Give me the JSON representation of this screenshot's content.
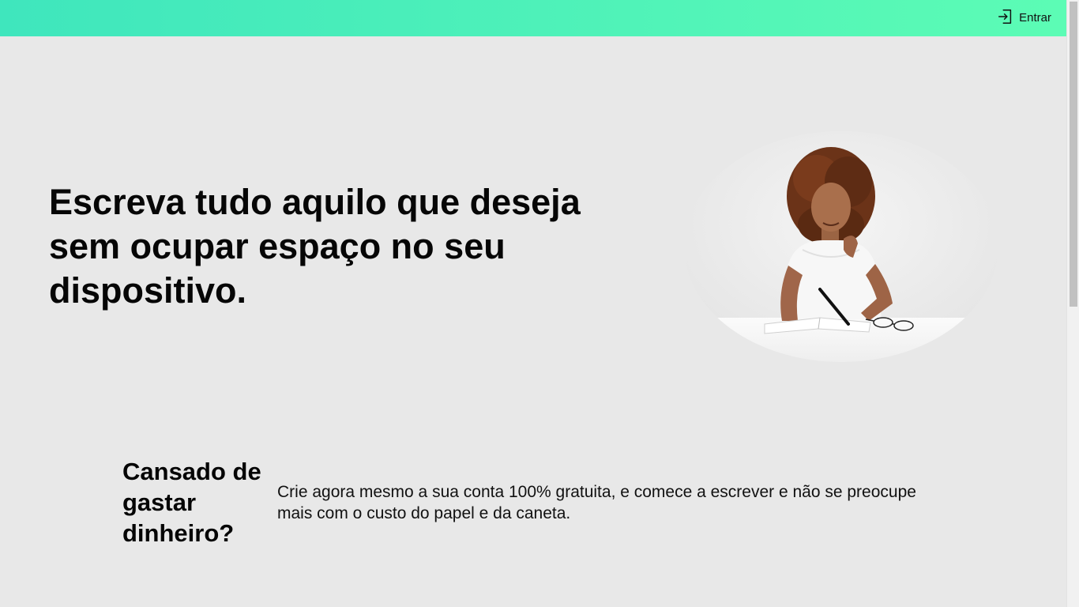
{
  "header": {
    "login_label": "Entrar",
    "login_icon": "login-icon",
    "gradient_start": "#3fe6bd",
    "gradient_end": "#5cfcb5"
  },
  "hero": {
    "title": "Escreva tudo aquilo que deseja sem ocupar espaço no seu dispositivo.",
    "image_subject": "woman-writing-in-notebook"
  },
  "feature": {
    "heading": "Cansado de gastar dinheiro?",
    "text": "Crie agora mesmo a sua conta 100% gratuita, e comece a escrever e não se preocupe mais com o custo do papel e da caneta."
  },
  "colors": {
    "background": "#e8e8e8",
    "text": "#050505"
  }
}
